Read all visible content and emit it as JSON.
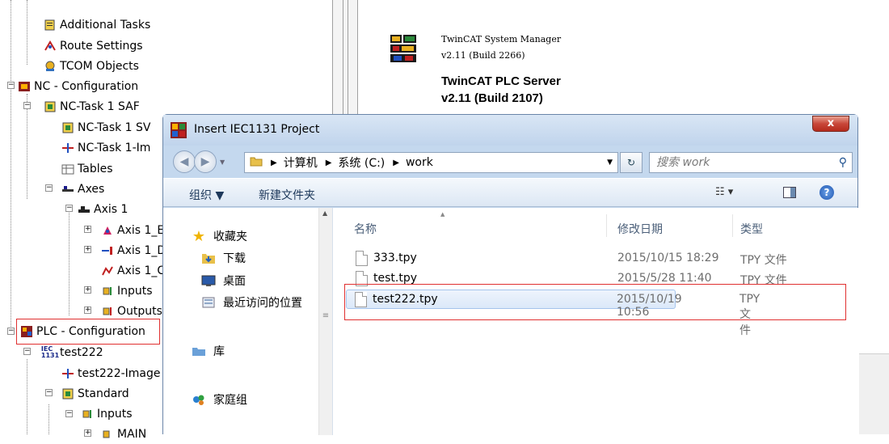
{
  "tree": {
    "items": [
      {
        "label": "Additional Tasks"
      },
      {
        "label": "Route Settings"
      },
      {
        "label": "TCOM Objects"
      },
      {
        "label": "NC - Configuration"
      },
      {
        "label": "NC-Task 1 SAF"
      },
      {
        "label": "NC-Task 1 SV"
      },
      {
        "label": "NC-Task 1-Im"
      },
      {
        "label": "Tables"
      },
      {
        "label": "Axes"
      },
      {
        "label": "Axis 1"
      },
      {
        "label": "Axis 1_E"
      },
      {
        "label": "Axis 1_D"
      },
      {
        "label": "Axis 1_C"
      },
      {
        "label": "Inputs"
      },
      {
        "label": "Outputs"
      },
      {
        "label": "PLC - Configuration"
      },
      {
        "label": "test222"
      },
      {
        "label": "test222-Image"
      },
      {
        "label": "Standard"
      },
      {
        "label": "Inputs"
      },
      {
        "label": "MAIN"
      }
    ]
  },
  "info": {
    "sm_name": "TwinCAT System Manager",
    "sm_version": "v2.11  (Build 2266)",
    "plc_name": "TwinCAT PLC Server",
    "plc_version": "v2.11 (Build 2107)"
  },
  "dialog": {
    "title": "Insert IEC1131 Project",
    "close_label": "x",
    "breadcrumb": [
      "计算机",
      "系统 (C:)",
      "work"
    ],
    "search_placeholder": "搜索 work",
    "toolbar": {
      "organize_label": "组织 ▼",
      "new_folder_label": "新建文件夹"
    },
    "nav": [
      {
        "label": "收藏夹",
        "icon": "star-icon"
      },
      {
        "label": "下载",
        "icon": "download-folder-icon"
      },
      {
        "label": "桌面",
        "icon": "desktop-icon"
      },
      {
        "label": "最近访问的位置",
        "icon": "recent-places-icon"
      },
      {
        "label": "库",
        "icon": "library-icon"
      },
      {
        "label": "家庭组",
        "icon": "homegroup-icon"
      }
    ],
    "columns": {
      "name": "名称",
      "date": "修改日期",
      "type": "类型"
    },
    "files": [
      {
        "name": "333.tpy",
        "date": "2015/10/15 18:29",
        "type": "TPY 文件"
      },
      {
        "name": "test.tpy",
        "date": "2015/5/28 11:40",
        "type": "TPY 文件"
      },
      {
        "name": "test222.tpy",
        "date": "2015/10/19 10:56",
        "type": "TPY 文件"
      }
    ]
  }
}
